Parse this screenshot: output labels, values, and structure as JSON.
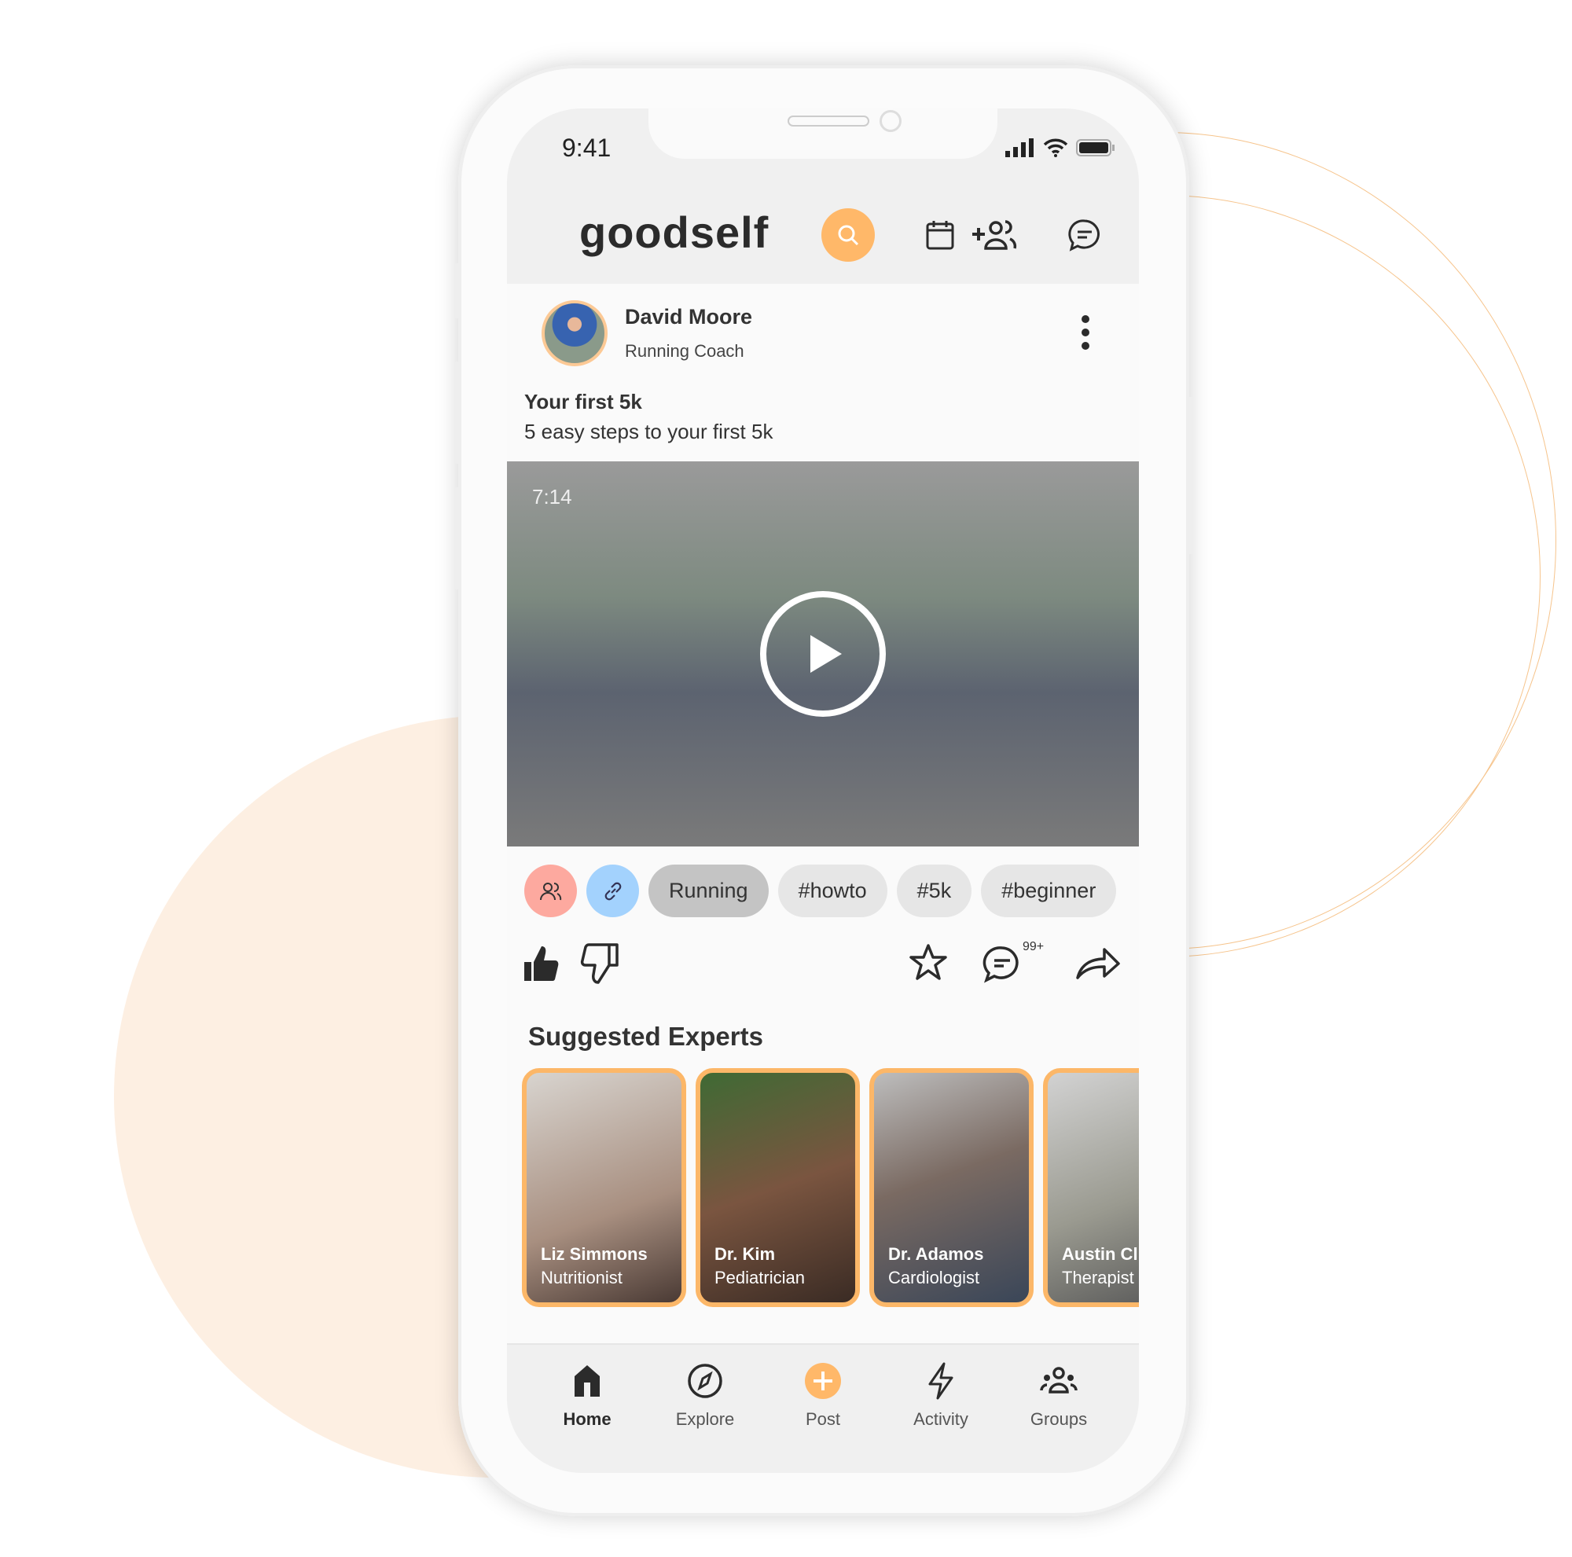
{
  "status_bar": {
    "time": "9:41"
  },
  "header": {
    "logo": "goodself",
    "icons": [
      "search-icon",
      "calendar-icon",
      "add-friends-icon",
      "messages-icon"
    ],
    "accent": "#ffb869"
  },
  "post": {
    "author": "David Moore",
    "role": "Running Coach",
    "title": "Your first 5k",
    "description": "5 easy steps to your first 5k",
    "video_duration": "7:14",
    "tags": [
      "Running",
      "#howto",
      "#5k",
      "#beginner"
    ],
    "comment_count": "99+"
  },
  "suggested": {
    "title": "Suggested Experts",
    "experts": [
      {
        "name": "Liz Simmons",
        "role": "Nutritionist"
      },
      {
        "name": "Dr. Kim",
        "role": "Pediatrician"
      },
      {
        "name": "Dr. Adamos",
        "role": "Cardiologist"
      },
      {
        "name": "Austin Cl",
        "role": "Therapist"
      }
    ]
  },
  "nav": {
    "items": [
      {
        "label": "Home"
      },
      {
        "label": "Explore"
      },
      {
        "label": "Post"
      },
      {
        "label": "Activity"
      },
      {
        "label": "Groups"
      }
    ]
  }
}
